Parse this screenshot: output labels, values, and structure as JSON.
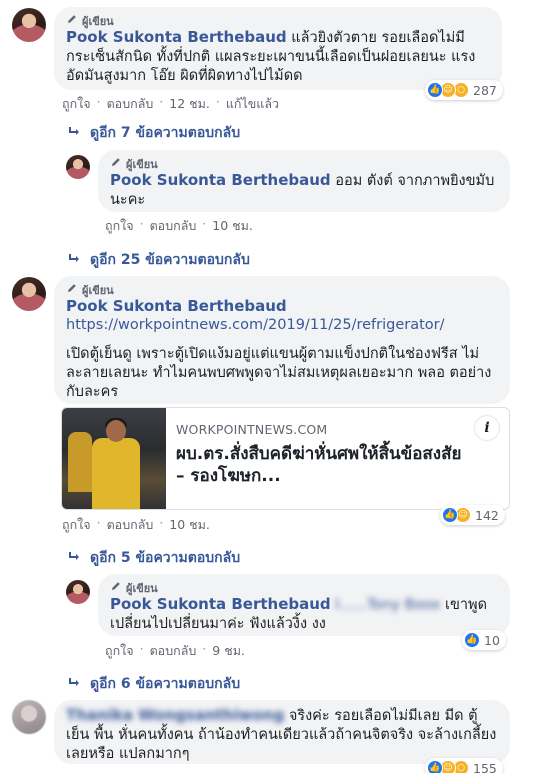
{
  "labels": {
    "author": "ผู้เขียน",
    "like": "ถูกใจ",
    "reply": "ตอบกลับ",
    "edited": "แก้ไขแล้ว",
    "sep": "·"
  },
  "comments": [
    {
      "name": "Pook Sukonta Berthebaud",
      "text_line1": "แล้วยิงตัวตาย รอยเลือดไม่มี",
      "text_rest": "กระเซ็นสักนิด ทั้งที่ปกติ แผลระยะเผาขนนี้เลือดเป็นฝอยเลยนะ แรงอัดมันสูงมาก โอ๊ย ผิดที่ผิดทางไปไม้ดด",
      "time": "12 ชม.",
      "reaction_count": "287",
      "view_more": "ดูอีก 7 ข้อความตอบกลับ"
    },
    {
      "name": "Pook Sukonta Berthebaud",
      "text_line1": "ออม ตังต์ จากภาพยิงขมับ",
      "text_rest": "นะคะ",
      "time": "10 ชม.",
      "view_more": "ดูอีก 25 ข้อความตอบกลับ"
    },
    {
      "name": "Pook Sukonta Berthebaud",
      "url": "https://workpointnews.com/2019/11/25/refrigerator/",
      "text": "เปิดตู้เย็นดู เพราะตู้เปิดแง้มอยู่แต่แขนผู้ตามแข็งปกติในช่องฟรีส ไม่ละลายเลยนะ ทำไมคนพบศพพูดจาไม่สมเหตุผลเยอะมาก พลอ ตอย่างกับละคร",
      "card": {
        "domain": "WORKPOINTNEWS.COM",
        "title": "ผบ.ตร.สั่งสืบคดีฆ่าหั่นศพให้สิ้นข้อสงสัย – รองโฆษก..."
      },
      "time": "10 ชม.",
      "reaction_count": "142",
      "view_more": "ดูอีก 5 ข้อความตอบกลับ"
    },
    {
      "name": "Pook Sukonta Berthebaud",
      "mention_blurred": "l......Tony Boox",
      "text_line1": "เขาพูด",
      "text_rest": "เปลี่ยนไปเปลี่ยนมาค่ะ ฟังแล้วงิ้ง งง",
      "time": "9 ชม.",
      "reaction_count": "10",
      "view_more": "ดูอีก 6 ข้อความตอบกลับ"
    },
    {
      "name_blurred": "Thanika Wongsanthiwong",
      "text_line1": "จริงค่ะ รอยเลือดไม่มีเลย มีด ตู้เย็น",
      "text_rest": "พื้น หั่นคนทั้งคน ถ้าน้องทำคนเดียวแล้วถ้าคนจิตจริง จะล้างเกลี้ยง เลยหรือ แปลกมากๆ",
      "reaction_count": "155"
    }
  ],
  "colors": {
    "name_link": "#385898",
    "bubble_bg": "#f2f3f5",
    "like_blue": "#1877f2",
    "haha_yellow": "#f7b125"
  },
  "icons": {
    "author_badge": "pencil-icon",
    "view_more": "reply-arrow-icon",
    "info": "info-icon"
  }
}
